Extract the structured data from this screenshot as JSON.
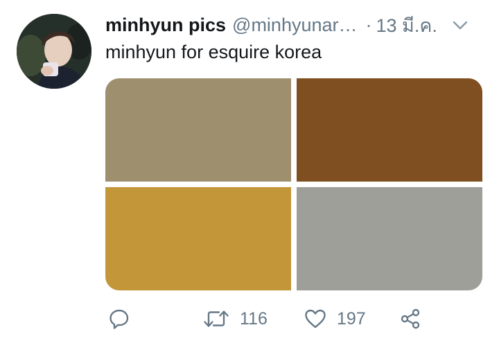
{
  "author": {
    "display_name": "minhyun pics",
    "handle": "@minhyunar…",
    "separator": "·",
    "timestamp": "13 มี.ค."
  },
  "tweet": {
    "text": "minhyun for esquire korea"
  },
  "media": {
    "tiles": [
      {
        "color": "#9e8f6e"
      },
      {
        "color": "#7f4f21"
      },
      {
        "color": "#c3963a"
      },
      {
        "color": "#9e9f98"
      }
    ]
  },
  "actions": {
    "retweet_count": "116",
    "like_count": "197"
  },
  "icons": {
    "reply": "reply-icon",
    "retweet": "retweet-icon",
    "like": "heart-icon",
    "share": "share-icon",
    "more": "chevron-down-icon"
  },
  "colors": {
    "text": "#14171a",
    "muted": "#657786"
  }
}
